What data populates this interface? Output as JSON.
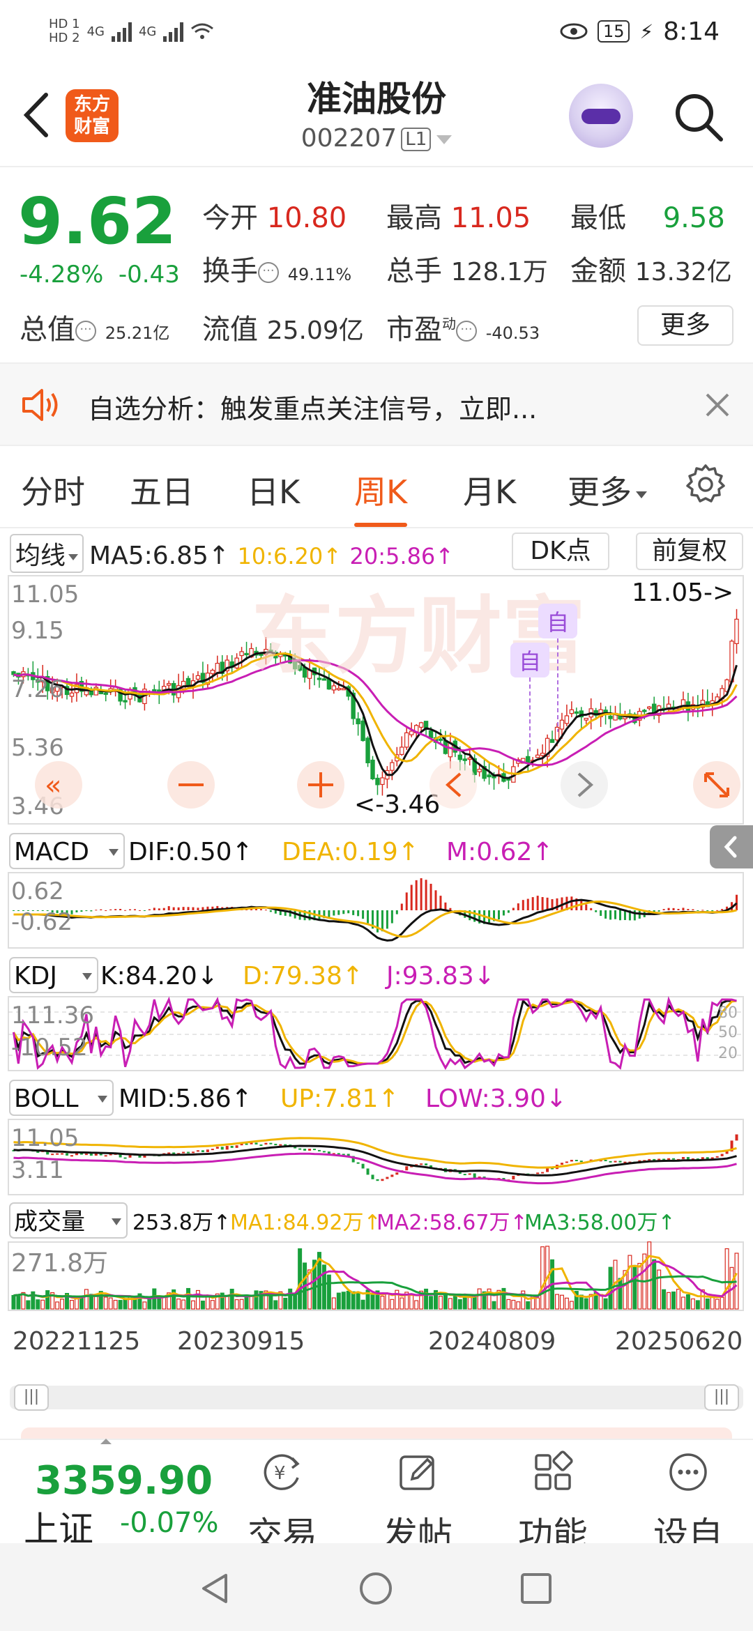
{
  "status_bar": {
    "hd1": "HD 1",
    "hd2": "HD 2",
    "net1": "4G",
    "net2": "4G",
    "battery": "15",
    "time": "8:14"
  },
  "header": {
    "logo_text": "东方财富",
    "stock_name": "准油股份",
    "stock_code": "002207",
    "level_tag": "L1"
  },
  "quote": {
    "price": "9.62",
    "change_pct": "-4.28%",
    "change_amt": "-0.43",
    "open_label": "今开",
    "open": "10.80",
    "high_label": "最高",
    "high": "11.05",
    "low_label": "最低",
    "low": "9.58",
    "turnover_label": "换手",
    "turnover": "49.11%",
    "volume_label": "总手",
    "volume": "128.1万",
    "amount_label": "金额",
    "amount": "13.32亿",
    "mktcap_label": "总值",
    "mktcap": "25.21亿",
    "float_label": "流值",
    "float": "25.09亿",
    "pe_label": "市盈",
    "pe_sup": "动",
    "pe": "-40.53",
    "more": "更多"
  },
  "notice": {
    "text": "自选分析：触发重点关注信号，立即..."
  },
  "tabs": [
    {
      "label": "分时"
    },
    {
      "label": "五日"
    },
    {
      "label": "日K"
    },
    {
      "label": "周K"
    },
    {
      "label": "月K"
    },
    {
      "label": "更多"
    }
  ],
  "ma_row": {
    "type": "均线",
    "ma5": "MA5:6.85↑",
    "ma10": "10:6.20↑",
    "ma20": "20:5.86↑",
    "dk": "DK点",
    "fq": "前复权"
  },
  "kline": {
    "y_top": "11.05",
    "y_2": "9.15",
    "y_3": "7.26",
    "y_4": "5.36",
    "y_bottom": "3.46",
    "max_note": "11.05->",
    "min_note": "<-3.46",
    "marker": "自"
  },
  "macd_row": {
    "name": "MACD",
    "dif": "DIF:0.50↑",
    "dea": "DEA:0.19↑",
    "m": "M:0.62↑",
    "y_top": "0.62",
    "y_bottom": "-0.62"
  },
  "kdj_row": {
    "name": "KDJ",
    "k": "K:84.20↓",
    "d": "D:79.38↑",
    "j": "J:93.83↓",
    "y_top": "111.36",
    "y_bottom": "-10.52",
    "r80": "80",
    "r50": "50",
    "r20": "20"
  },
  "boll_row": {
    "name": "BOLL",
    "mid": "MID:5.86↑",
    "up": "UP:7.81↑",
    "low": "LOW:3.90↓",
    "y_top": "11.05",
    "y_bottom": "3.11"
  },
  "vol_row": {
    "name": "成交量",
    "vol": "253.8万↑",
    "ma1": "MA1:84.92万↑",
    "ma2": "MA2:58.67万↑",
    "ma3": "MA3:58.00万↑",
    "y_top": "271.8万"
  },
  "dates": [
    "20221125",
    "20230915",
    "20240809",
    "20250620"
  ],
  "scroller": {
    "grip": "|||"
  },
  "bottom": {
    "index_value": "3359.90",
    "index_name": "上证",
    "index_change": "-0.07%",
    "nav": [
      "交易",
      "发帖",
      "功能",
      "设自选"
    ]
  },
  "colors": {
    "up": "#d8281e",
    "down": "#19a03c",
    "accent": "#f05a1a",
    "ma10": "#f0b400",
    "ma20": "#c81eb4"
  }
}
